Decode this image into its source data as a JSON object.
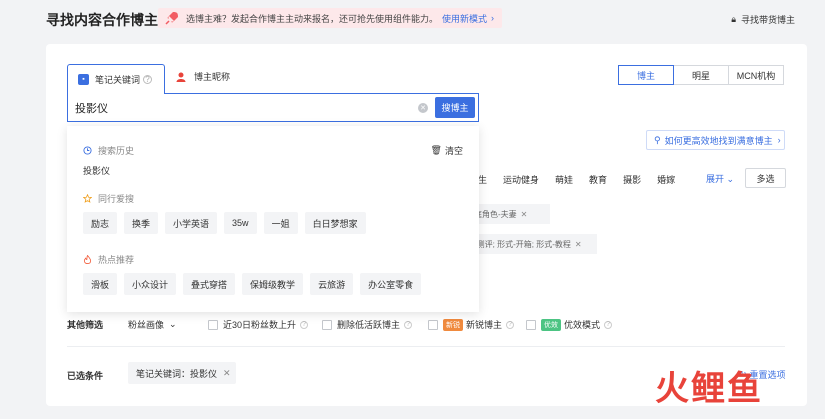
{
  "header": {
    "title": "寻找内容合作博主",
    "banner_text": "选博主难？发起合作博主主动来报名，还可抢先使用组件能力。",
    "banner_link": "使用新模式",
    "right_link": "寻找带货博主"
  },
  "search": {
    "tabs": [
      {
        "label": "笔记关键词"
      },
      {
        "label": "博主昵称"
      }
    ],
    "query": "投影仪",
    "button_label": "搜博主"
  },
  "roles": [
    {
      "label": "博主",
      "active": true
    },
    {
      "label": "明星",
      "active": false
    },
    {
      "label": "MCN机构",
      "active": false
    }
  ],
  "help_link": "如何更高效地找到满意博主",
  "categories": [
    "生",
    "运动健身",
    "萌娃",
    "教育",
    "摄影",
    "婚嫁"
  ],
  "expand_label": "展开",
  "more_label": "多选",
  "partial_chips": [
    "家庭角色-夫妻",
    "式-测评; 形式-开箱; 形式-教程"
  ],
  "dropdown": {
    "history_title": "搜索历史",
    "clear_label": "清空",
    "history_items": [
      "投影仪"
    ],
    "peer_title": "同行爱搜",
    "peer_tags": [
      "励志",
      "换季",
      "小学英语",
      "35w",
      "一姐",
      "白日梦想家"
    ],
    "hot_title": "热点推荐",
    "hot_tags": [
      "滑板",
      "小众设计",
      "叠式穿搭",
      "保姆级教学",
      "云旅游",
      "办公室零食"
    ]
  },
  "filters": {
    "label": "其他筛选",
    "fan_portrait": "粉丝画像",
    "fan_growth": "近30日粉丝数上升",
    "remove_inactive": "删除低活跃博主",
    "new_badge": "新锐",
    "new_blogger": "新锐博主",
    "quality_badge": "优效",
    "quality_mode": "优效模式"
  },
  "selected": {
    "label": "已选条件",
    "chip": "笔记关键词：投影仪",
    "reset_label": "重置选项"
  },
  "watermark": "火鲤鱼",
  "colors": {
    "primary": "#3b6fe0",
    "banner_bg": "#fde8ea",
    "new_badge": "#f08a3e",
    "quality_badge": "#4cc483",
    "watermark": "#e8433a"
  }
}
